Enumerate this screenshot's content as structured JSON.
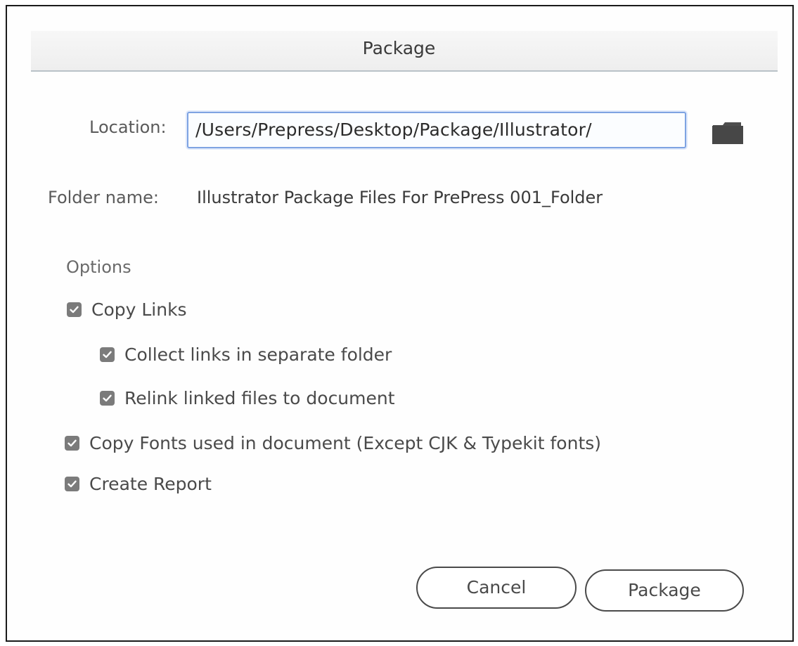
{
  "dialog": {
    "title": "Package",
    "location_label": "Location:",
    "location_value": "/Users/Prepress/Desktop/Package/Illustrator/",
    "folder_label": "Folder name:",
    "folder_value": "Illustrator Package Files For PrePress 001_Folder",
    "browse_icon": "folder-icon",
    "options_label": "Options",
    "options": {
      "copy_links": {
        "label": "Copy Links",
        "checked": true
      },
      "collect_links": {
        "label": "Collect links in separate folder",
        "checked": true
      },
      "relink_files": {
        "label": "Relink linked files to document",
        "checked": true
      },
      "copy_fonts": {
        "label": "Copy Fonts used in document (Except CJK & Typekit fonts)",
        "checked": true
      },
      "create_report": {
        "label": "Create Report",
        "checked": true
      }
    },
    "cancel_label": "Cancel",
    "package_label": "Package"
  }
}
